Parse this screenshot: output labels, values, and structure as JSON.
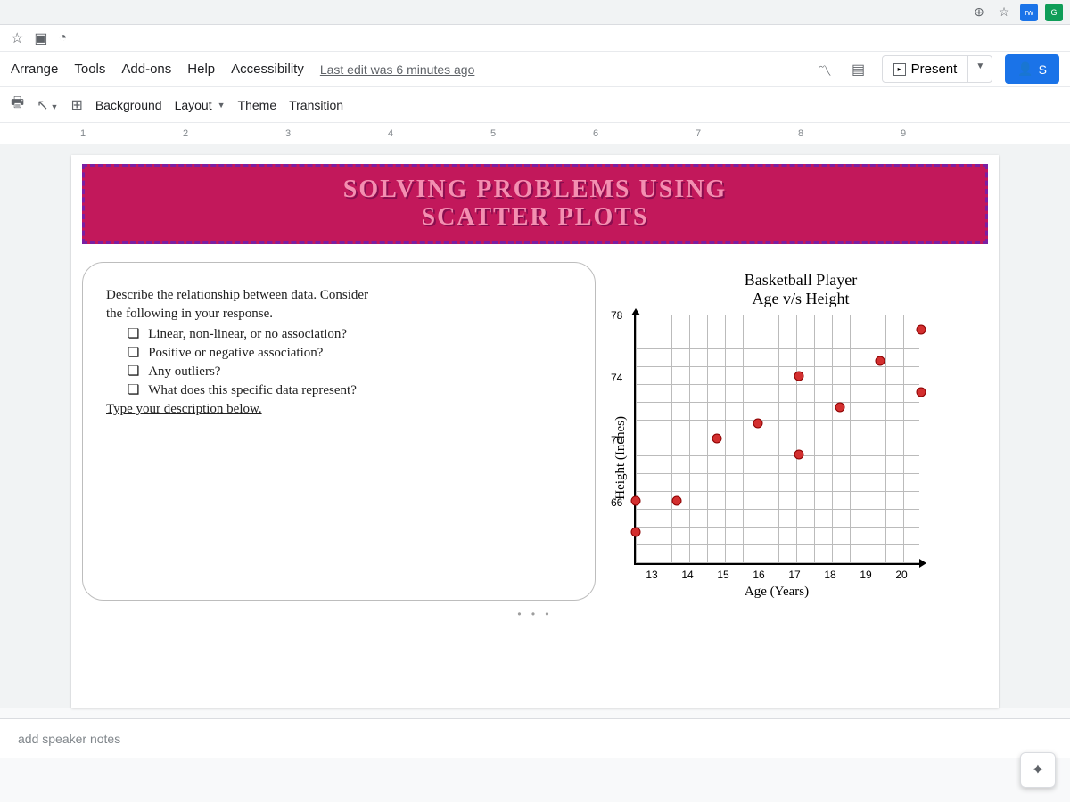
{
  "menubar": {
    "items": [
      "Arrange",
      "Tools",
      "Add-ons",
      "Help",
      "Accessibility"
    ],
    "edit_info": "Last edit was 6 minutes ago",
    "present_label": "Present",
    "share_label": "S"
  },
  "toolbar": {
    "background": "Background",
    "layout": "Layout",
    "theme": "Theme",
    "transition": "Transition"
  },
  "ruler": {
    "marks": [
      "1",
      "2",
      "3",
      "4",
      "5",
      "6",
      "7",
      "8",
      "9"
    ]
  },
  "slide": {
    "title_line1": "SOLVING PROBLEMS USING",
    "title_line2": "SCATTER PLOTS",
    "prompt_intro1": "Describe the relationship between data. Consider",
    "prompt_intro2": "the following in your response.",
    "bullets": [
      "Linear, non-linear, or no association?",
      "Positive or negative association?",
      "Any outliers?",
      "What does this specific data represent?"
    ],
    "type_below": "Type your description below."
  },
  "chart_data": {
    "type": "scatter",
    "title": "Basketball Player\nAge v/s Height",
    "xlabel": "Age (Years)",
    "ylabel": "Height (Inches)",
    "xlim": [
      13,
      20
    ],
    "ylim": [
      62,
      78
    ],
    "xticks": [
      13,
      14,
      15,
      16,
      17,
      18,
      19,
      20
    ],
    "yticks": [
      66,
      70,
      74,
      78
    ],
    "points": [
      {
        "x": 13,
        "y": 66
      },
      {
        "x": 13,
        "y": 64
      },
      {
        "x": 14,
        "y": 66
      },
      {
        "x": 15,
        "y": 70
      },
      {
        "x": 16,
        "y": 71
      },
      {
        "x": 17,
        "y": 69
      },
      {
        "x": 17,
        "y": 74
      },
      {
        "x": 18,
        "y": 72
      },
      {
        "x": 19,
        "y": 75
      },
      {
        "x": 20,
        "y": 73
      },
      {
        "x": 20,
        "y": 77
      }
    ]
  },
  "speaker_notes": {
    "placeholder": "add speaker notes"
  }
}
